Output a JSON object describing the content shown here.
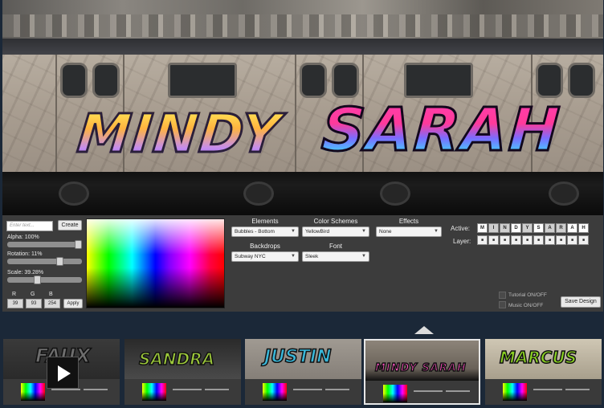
{
  "preview": {
    "graffiti_left": "MINDY",
    "graffiti_right": "SARAH"
  },
  "controls": {
    "text_placeholder": "Enter text...",
    "create_label": "Create",
    "alpha_label": "Alpha: 100%",
    "alpha_value": 1.0,
    "rotation_label": "Rotation: 11%",
    "rotation_value": 0.11,
    "scale_label": "Scale: 39.28%",
    "scale_value": 0.3928,
    "r_label": "R",
    "g_label": "G",
    "b_label": "B",
    "r_value": "39",
    "g_value": "93",
    "b_value": "254",
    "apply_label": "Apply"
  },
  "dropdowns": {
    "elements_label": "Elements",
    "elements_value": "Bubbles - Bottom",
    "color_schemes_label": "Color Schemes",
    "color_schemes_value": "YellowBird",
    "effects_label": "Effects",
    "effects_value": "None",
    "backdrops_label": "Backdrops",
    "backdrops_value": "Subway NYC",
    "font_label": "Font",
    "font_value": "Sleek"
  },
  "layers": {
    "active_label": "Active:",
    "layer_label": "Layer:",
    "letters": [
      "M",
      "I",
      "N",
      "D",
      "Y",
      "S",
      "A",
      "R",
      "A",
      "H"
    ],
    "layer_mark": "■"
  },
  "options": {
    "tutorial_label": "Tutorial ON/OFF",
    "music_label": "Music ON/OFF",
    "save_label": "Save Design"
  },
  "thumbnails": [
    {
      "word": "FAUX",
      "selected": false,
      "video": true
    },
    {
      "word": "SANDRA",
      "selected": false,
      "video": false
    },
    {
      "word": "JUSTIN",
      "selected": false,
      "video": false
    },
    {
      "word": "MINDY SARAH",
      "selected": true,
      "video": false
    },
    {
      "word": "MARCUS",
      "selected": false,
      "video": false
    }
  ],
  "icons": {
    "dropdown": "chevron-down-icon",
    "play": "play-icon"
  }
}
